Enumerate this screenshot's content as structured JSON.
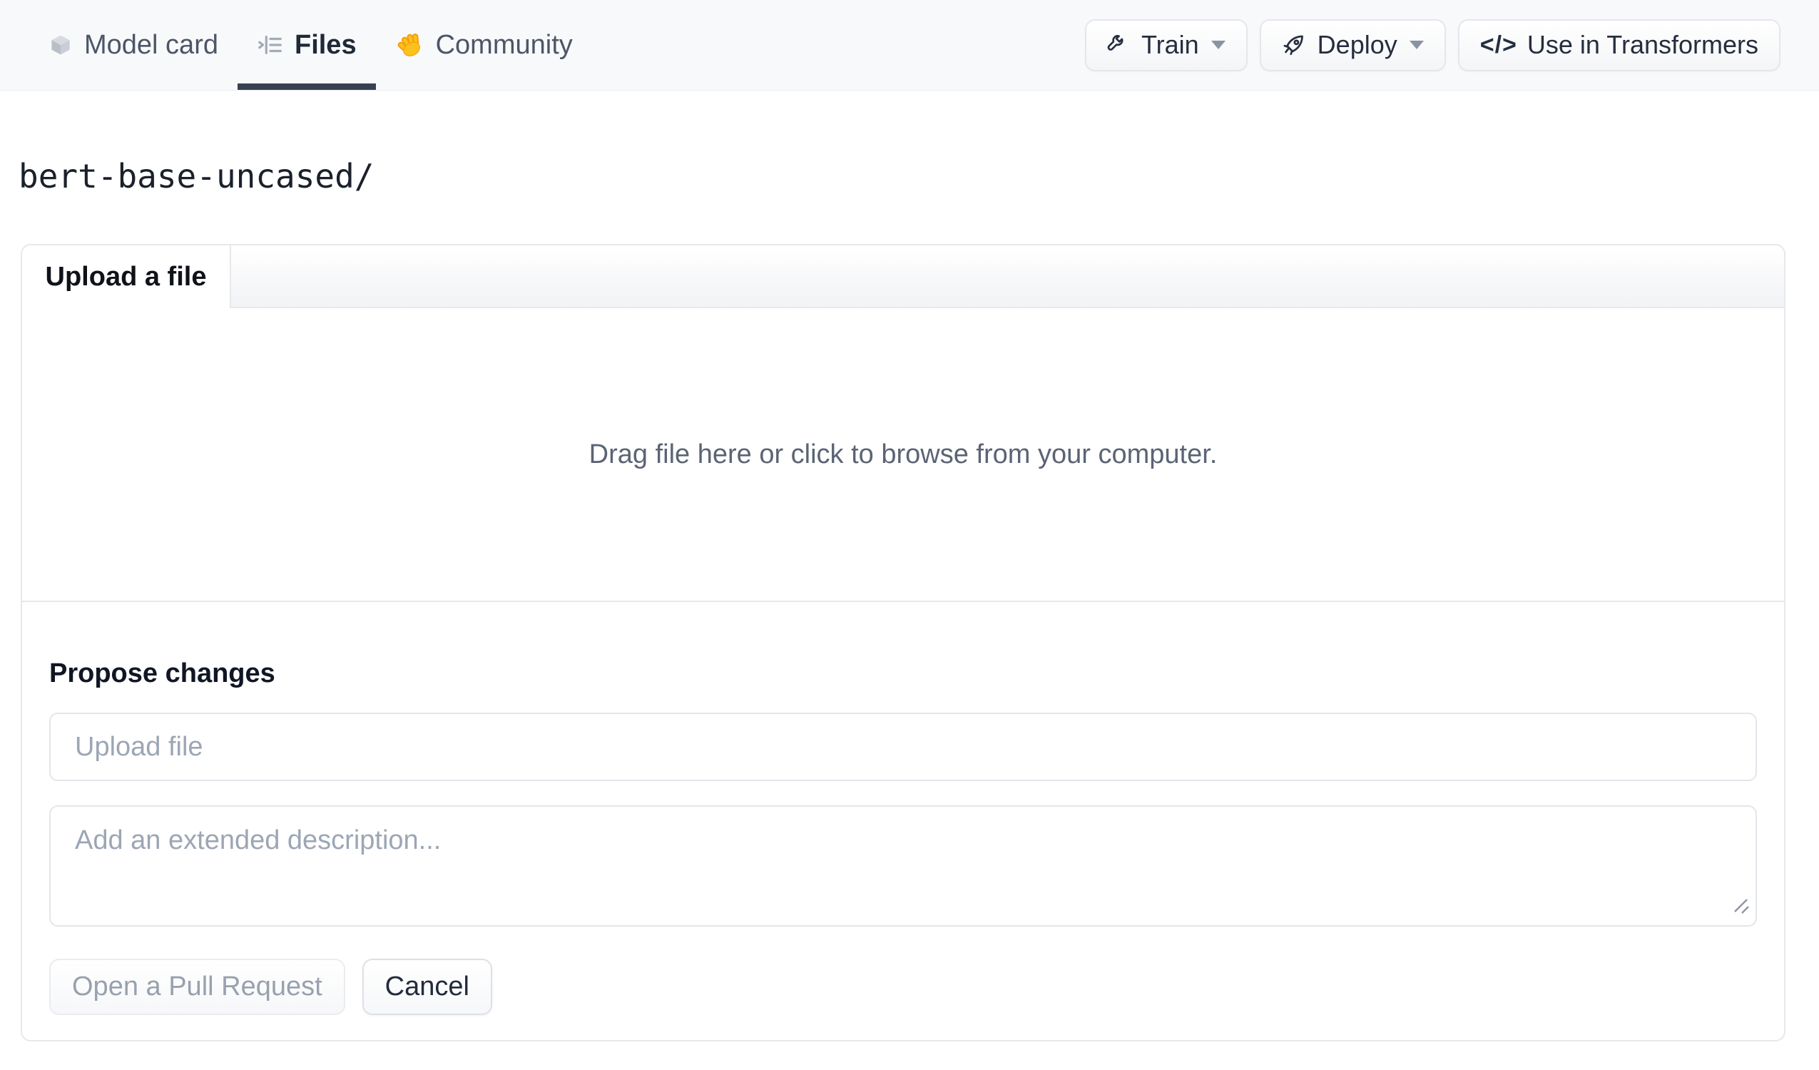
{
  "header": {
    "tabs": [
      {
        "label": "Model card",
        "icon": "cube-icon",
        "active": false
      },
      {
        "label": "Files",
        "icon": "files-list-icon",
        "active": true
      },
      {
        "label": "Community",
        "icon": "waving-hand-icon",
        "active": false
      }
    ],
    "actions": {
      "train_label": "Train",
      "deploy_label": "Deploy",
      "use_in_transformers_label": "Use in Transformers",
      "train_icon": "wrench-icon",
      "deploy_icon": "rocket-icon",
      "use_icon": "code-icon",
      "code_glyph": "</>"
    }
  },
  "breadcrumb": "bert-base-uncased/",
  "upload_card": {
    "tab_label": "Upload a file",
    "dropzone_text": "Drag file here or click to browse from your computer.",
    "propose": {
      "title": "Propose changes",
      "filename_placeholder": "Upload file",
      "filename_value": "",
      "description_placeholder": "Add an extended description...",
      "description_value": "",
      "open_pr_label": "Open a Pull Request",
      "open_pr_enabled": false,
      "cancel_label": "Cancel"
    }
  },
  "colors": {
    "topbar_bg": "#f8f9fb",
    "active_tab_underline": "#374151",
    "active_text": "#1f2937",
    "muted_text": "#4c5667",
    "dropzone_text": "#5b6474",
    "placeholder": "#9ca6b4",
    "border": "#e6e8ec",
    "hand_emoji_yellow": "#fcc21b"
  }
}
